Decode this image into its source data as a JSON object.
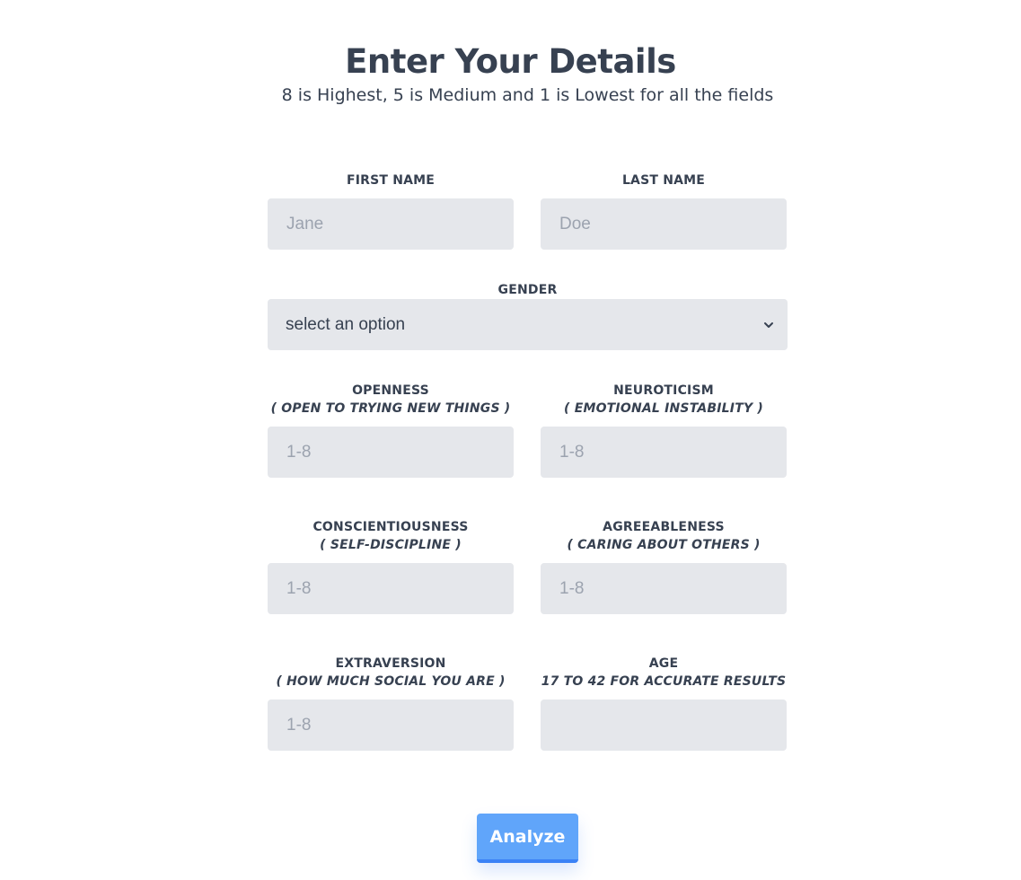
{
  "header": {
    "title": "Enter Your Details",
    "subtitle": "8 is Highest, 5 is Medium and 1 is Lowest for all the fields"
  },
  "fields": {
    "first_name": {
      "label": "First Name",
      "placeholder": "Jane"
    },
    "last_name": {
      "label": "Last Name",
      "placeholder": "Doe"
    },
    "gender": {
      "label": "Gender",
      "selected": "select an option"
    },
    "openness": {
      "label": "Openness",
      "hint": "( Open to trying new things )",
      "placeholder": "1-8"
    },
    "neuroticism": {
      "label": "Neuroticism",
      "hint": "( Emotional Instability )",
      "placeholder": "1-8"
    },
    "conscientiousness": {
      "label": "Conscientiousness",
      "hint": "( Self-Discipline )",
      "placeholder": "1-8"
    },
    "agreeableness": {
      "label": "Agreeableness",
      "hint": "( Caring about others )",
      "placeholder": "1-8"
    },
    "extraversion": {
      "label": "Extraversion",
      "hint": "( How much social you are )",
      "placeholder": "1-8"
    },
    "age": {
      "label": "Age",
      "hint": "17 to 42 for accurate results",
      "placeholder": ""
    }
  },
  "actions": {
    "submit_label": "Analyze"
  },
  "colors": {
    "input_bg": "#e5e7eb",
    "text": "#374151",
    "placeholder": "#9ca3af",
    "button": "#60a5fa",
    "button_border": "#3b82f6"
  },
  "icons": {
    "select_arrow": "chevron-down-icon"
  }
}
